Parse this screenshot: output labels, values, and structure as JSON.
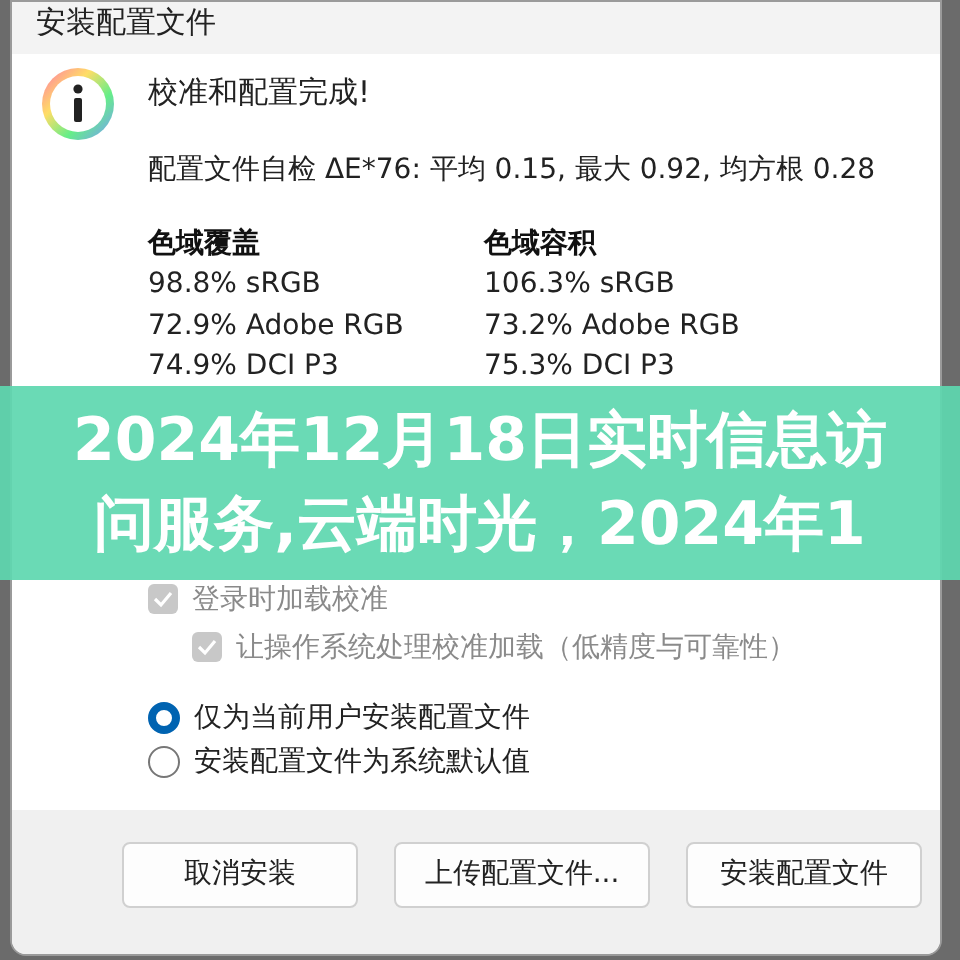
{
  "window": {
    "title": "安装配置文件"
  },
  "message": {
    "heading": "校准和配置完成!",
    "self_check": "配置文件自检 ΔE*76: 平均 0.15, 最大 0.92, 均方根 0.28"
  },
  "gamut": [
    {
      "title": "色域覆盖",
      "rows": [
        "98.8% sRGB",
        "72.9% Adobe RGB",
        "74.9% DCI P3"
      ]
    },
    {
      "title": "色域容积",
      "rows": [
        "106.3% sRGB",
        "73.2% Adobe RGB",
        "75.3% DCI P3"
      ]
    }
  ],
  "checkboxes": [
    {
      "label": "登录时加载校准",
      "checked": true,
      "disabled": true,
      "children": [
        {
          "label": "让操作系统处理校准加载（低精度与可靠性）",
          "checked": true,
          "disabled": true
        }
      ]
    }
  ],
  "radios": [
    {
      "label": "仅为当前用户安装配置文件",
      "selected": true
    },
    {
      "label": "安装配置文件为系统默认值",
      "selected": false
    }
  ],
  "buttons": [
    "取消安装",
    "上传配置文件...",
    "安装配置文件"
  ],
  "banner": {
    "lines": [
      "2024年12月18日实时信息访",
      "问服务,云端时光，2024年1"
    ]
  }
}
